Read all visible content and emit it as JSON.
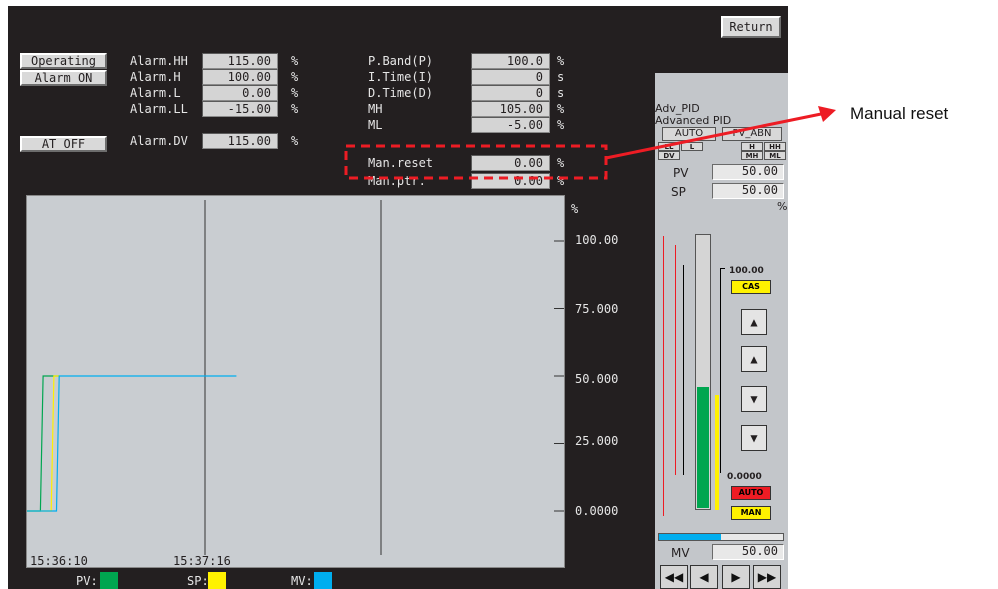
{
  "header": {
    "return_label": "Return"
  },
  "status_buttons": {
    "operating": "Operating",
    "alarm_on": "Alarm ON",
    "at_off": "AT OFF"
  },
  "alarms": [
    {
      "label": "Alarm.HH",
      "value": "115.00",
      "unit": "%"
    },
    {
      "label": "Alarm.H",
      "value": "100.00",
      "unit": "%"
    },
    {
      "label": "Alarm.L",
      "value": "0.00",
      "unit": "%"
    },
    {
      "label": "Alarm.LL",
      "value": "-15.00",
      "unit": "%"
    },
    {
      "label": "Alarm.DV",
      "value": "115.00",
      "unit": "%"
    }
  ],
  "pid_params": [
    {
      "label": "P.Band(P)",
      "value": "100.0",
      "unit": "%"
    },
    {
      "label": "I.Time(I)",
      "value": "0",
      "unit": "s"
    },
    {
      "label": "D.Time(D)",
      "value": "0",
      "unit": "s"
    },
    {
      "label": "MH",
      "value": "105.00",
      "unit": "%"
    },
    {
      "label": "ML",
      "value": "-5.00",
      "unit": "%"
    },
    {
      "label": "Man.reset",
      "value": "0.00",
      "unit": "%"
    },
    {
      "label": "Man.ptr.",
      "value": "0.00",
      "unit": "%"
    }
  ],
  "trend": {
    "unit": "%",
    "y_ticks": [
      "100.00",
      "75.000",
      "50.000",
      "25.000",
      "0.0000"
    ],
    "time_labels": [
      "15:36:10",
      "15:37:16"
    ],
    "legend": [
      {
        "label": "PV:",
        "color": "#00a650"
      },
      {
        "label": "SP:",
        "color": "#fff200"
      },
      {
        "label": "MV:",
        "color": "#00aeef"
      }
    ]
  },
  "chart_data": {
    "type": "line",
    "ylim": [
      0,
      100
    ],
    "unit": "%",
    "y_ticks": [
      100,
      75,
      50,
      25,
      0
    ],
    "time_labels": [
      "15:36:10",
      "15:37:16"
    ],
    "series": [
      {
        "name": "PV",
        "color": "#00a650",
        "points": [
          [
            0,
            0
          ],
          [
            0.025,
            0
          ],
          [
            0.03,
            50
          ],
          [
            0.06,
            50
          ]
        ]
      },
      {
        "name": "SP",
        "color": "#fff200",
        "points": [
          [
            0,
            0
          ],
          [
            0.045,
            0
          ],
          [
            0.05,
            50
          ],
          [
            0.06,
            50
          ]
        ]
      },
      {
        "name": "MV",
        "color": "#00aeef",
        "points": [
          [
            0,
            0
          ],
          [
            0.055,
            0
          ],
          [
            0.06,
            50
          ],
          [
            0.39,
            50
          ]
        ]
      }
    ]
  },
  "faceplate": {
    "tag": "Adv_PID",
    "desc": "Advanced PID",
    "mode": "AUTO",
    "pv_abn": "PV_ABN",
    "alarm_lamps": [
      "LL",
      "L",
      "H",
      "HH",
      "DV",
      "MH",
      "ML"
    ],
    "pv_label": "PV",
    "pv_value": "50.00",
    "sp_label": "SP",
    "sp_value": "50.00",
    "unit": "%",
    "scale_top": "100.00",
    "scale_bottom": "0.0000",
    "cas_label": "CAS",
    "auto_label": "AUTO",
    "man_label": "MAN",
    "mv_label": "MV",
    "mv_value": "50.00",
    "pv_bar_level": 50,
    "sp_bar_level": 50,
    "mv_bar_level": 50,
    "colors": {
      "cas": "#fff200",
      "auto": "#ed1c24",
      "man": "#fff200",
      "bar_pv": "#00a650",
      "bar_sp": "#fff200",
      "bar_mv": "#00aeef"
    }
  },
  "annotation": {
    "label": "Manual reset",
    "color": "#ed1c24"
  }
}
